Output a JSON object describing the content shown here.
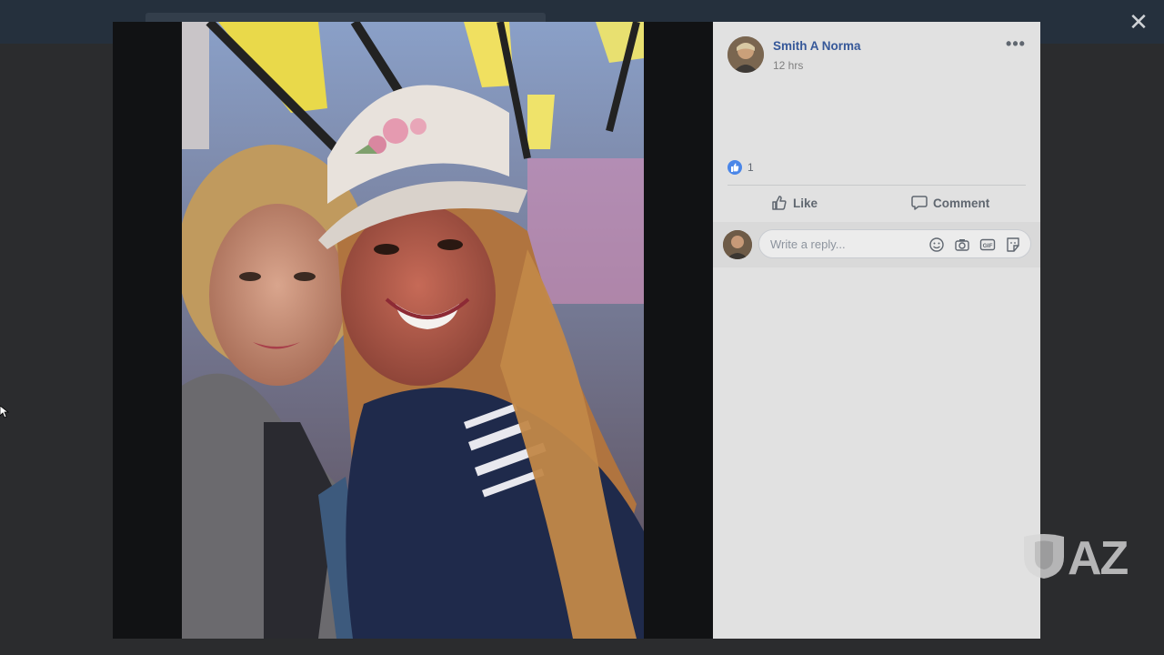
{
  "viewer": {
    "close_icon": "close-icon"
  },
  "post": {
    "author_name": "Smith A Norma",
    "time": "12 hrs",
    "more_icon": "more-options-icon",
    "reaction_count": "1",
    "actions": {
      "like_label": "Like",
      "comment_label": "Comment"
    }
  },
  "reply": {
    "placeholder": "Write a reply...",
    "icons": [
      "emoji-icon",
      "camera-icon",
      "gif-icon",
      "sticker-icon"
    ]
  },
  "watermark": {
    "text": "AZ"
  },
  "colors": {
    "link": "#365899",
    "like_badge": "#4a86e8"
  }
}
